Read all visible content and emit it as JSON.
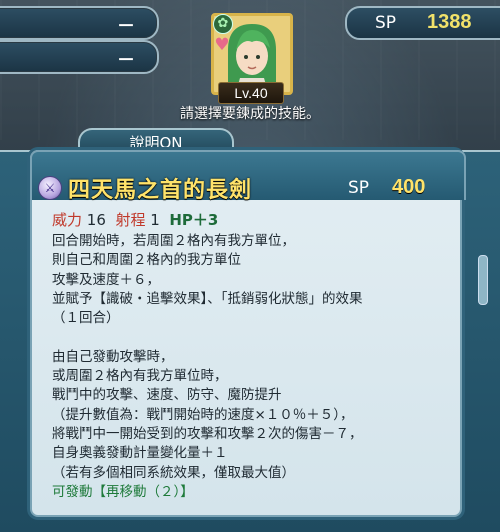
{
  "top": {
    "bar1_value": "－",
    "bar2_value": "－",
    "sp_label": "SP",
    "sp_value": "1388"
  },
  "unit": {
    "level": "Lv.40"
  },
  "instruction": "請選擇要鍊成的技能。",
  "tab_label": "說明ON",
  "skill": {
    "name": "四天馬之首的長劍",
    "sp_label": "SP",
    "sp_value": "400",
    "stat_might_label": "威力",
    "stat_might": "16",
    "stat_range_label": "射程",
    "stat_range": "1",
    "stat_hp": "HP＋3",
    "description": [
      "回合開始時，若周圍２格內有我方單位，",
      "則自己和周圍２格內的我方單位",
      "攻擊及速度＋６，",
      "並賦予【識破・追擊效果】、「抵銷弱化狀態」的效果",
      "（１回合）",
      "",
      "由自己發動攻擊時，",
      "或周圍２格內有我方單位時，",
      "戰鬥中的攻擊、速度、防守、魔防提升",
      "（提升數值為：戰鬥開始時的速度×１０％＋５），",
      "將戰鬥中一開始受到的攻擊和攻擊２次的傷害－７，",
      "自身奧義發動計量變化量＋１",
      "（若有多個相同系統效果，僅取最大值）"
    ],
    "trigger_line": "可發動【再移動（２）】"
  },
  "colors": {
    "gold": "#ffe36a",
    "panel": "#2d6279",
    "card": "#e3eef3"
  }
}
